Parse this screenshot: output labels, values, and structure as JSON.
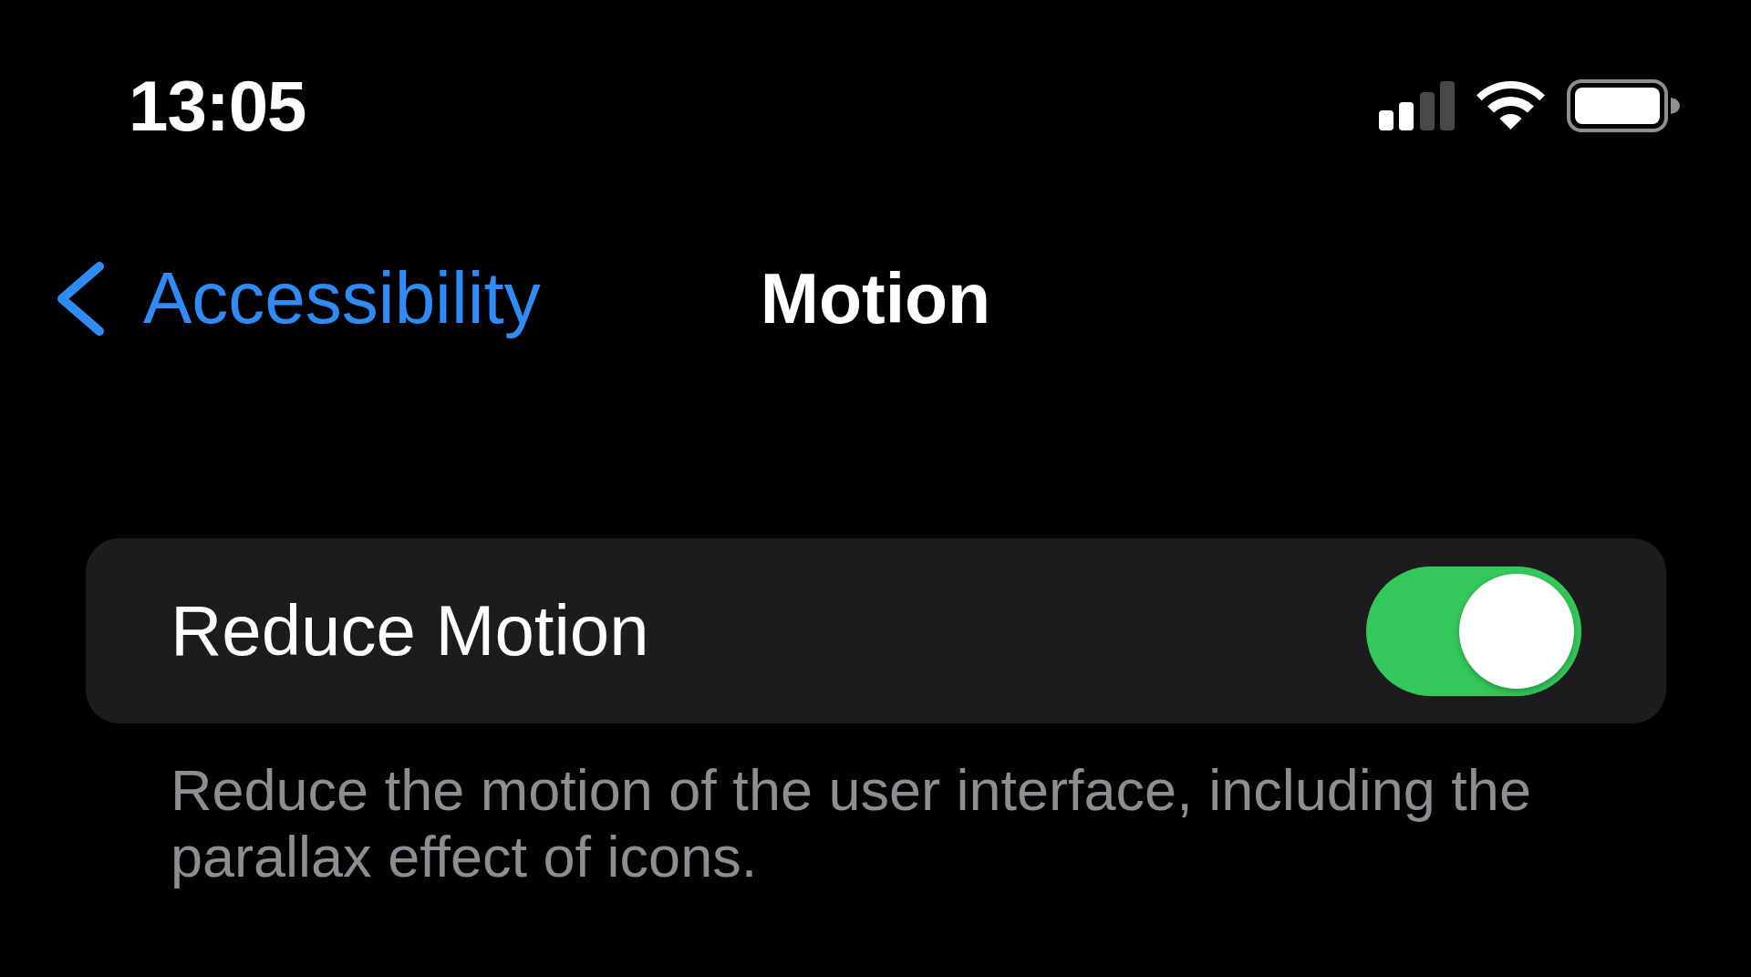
{
  "status_bar": {
    "time": "13:05"
  },
  "nav_bar": {
    "back_label": "Accessibility",
    "title": "Motion"
  },
  "settings": [
    {
      "kind": "toggle",
      "label": "Reduce Motion",
      "on": true
    }
  ],
  "footer": "Reduce the motion of the user interface, including the parallax effect of icons."
}
